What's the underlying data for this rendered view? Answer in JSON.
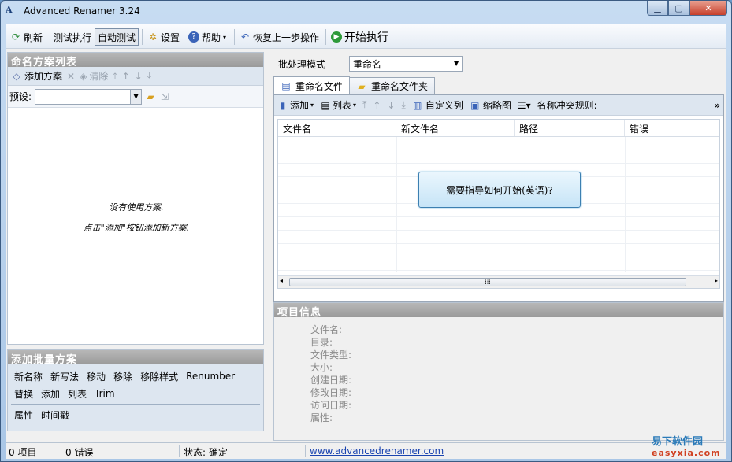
{
  "window": {
    "title": "Advanced Renamer 3.24",
    "app_icon": "A"
  },
  "toolbar": {
    "refresh": "刷新",
    "test_run": "测试执行",
    "auto_test": "自动测试",
    "settings": "设置",
    "help": "帮助",
    "undo": "恢复上一步操作",
    "start": "开始执行"
  },
  "left": {
    "title": "命名方案列表",
    "add_method": "添加方案",
    "clear": "清除",
    "preset_label": "预设:",
    "preset_value": "",
    "empty_line1": "没有使用方案.",
    "empty_line2": "点击\"添加\"按钮添加新方案."
  },
  "batch": {
    "title": "添加批量方案",
    "row1": [
      "新名称",
      "新写法",
      "移动",
      "移除",
      "移除样式",
      "Renumber"
    ],
    "row2": [
      "替换",
      "添加",
      "列表",
      "Trim"
    ],
    "row3": [
      "属性",
      "时间戳"
    ]
  },
  "right": {
    "mode_label": "批处理模式",
    "mode_value": "重命名",
    "tab_files": "重命名文件",
    "tab_folders": "重命名文件夹",
    "add": "添加",
    "list": "列表",
    "custom_columns": "自定义列",
    "thumbnails": "缩略图",
    "name_conflict": "名称冲突规则:",
    "columns": [
      "文件名",
      "新文件名",
      "路径",
      "错误"
    ],
    "help_button": "需要指导如何开始(英语)?"
  },
  "info": {
    "title": "项目信息",
    "fields": [
      "文件名:",
      "目录:",
      "文件类型:",
      "大小:",
      "创建日期:",
      "修改日期:",
      "访问日期:",
      "属性:"
    ]
  },
  "status": {
    "items": "0 项目",
    "errors": "0 错误",
    "state": "状态: 确定",
    "link": "www.advancedrenamer.com"
  },
  "watermark": {
    "line1": "易下软件园",
    "line2": "easyxia.com"
  },
  "colors": {
    "accent": "#3c7fb1",
    "panel_header": "#a8a8a8",
    "link": "#1a44b0"
  }
}
